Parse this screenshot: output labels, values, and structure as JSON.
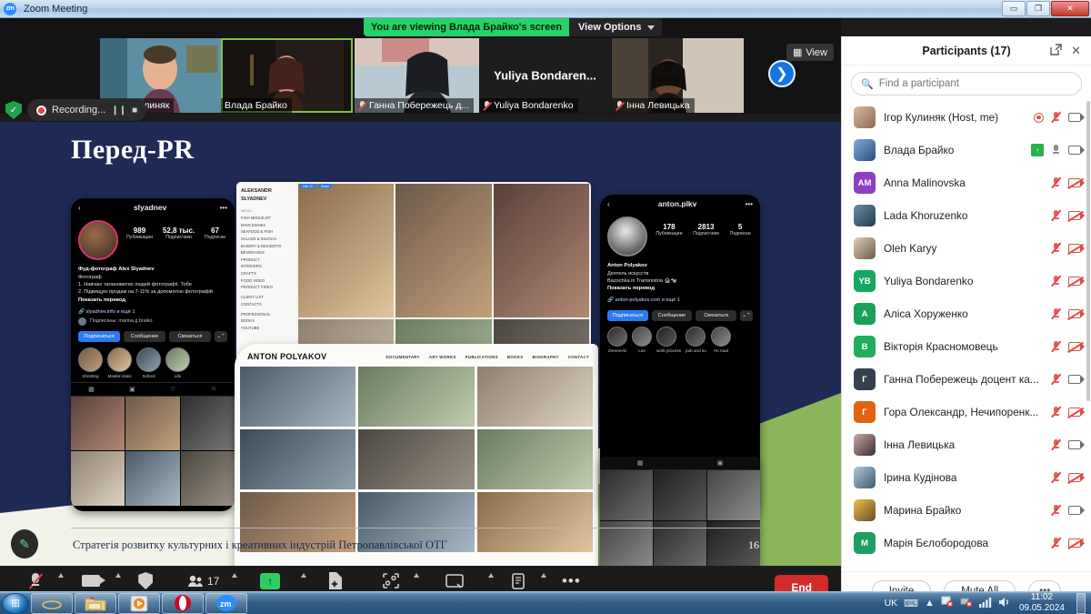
{
  "window": {
    "title": "Zoom Meeting",
    "app_icon": "zoom-icon",
    "minimize": "–",
    "restore": "❐",
    "close": "✕"
  },
  "share_banner": {
    "text": "You are viewing Влада Брайко's screen",
    "view_options": "View Options"
  },
  "recording": {
    "shield_icon": "encryption-shield-icon",
    "label": "Recording...",
    "pause_icon": "❙❙",
    "stop_icon": "■"
  },
  "filmstrip": {
    "view_button": "View",
    "next_icon": "❯",
    "thumbs": [
      {
        "name": "Ігор Кулиняк",
        "muted": true,
        "active": false,
        "centered": false
      },
      {
        "name": "Влада Брайко",
        "muted": false,
        "active": true,
        "centered": false
      },
      {
        "name": "Ганна Побережець д...",
        "muted": true,
        "active": false,
        "centered": false
      },
      {
        "name": "Yuliya Bondarenko",
        "center_name": "Yuliya  Bondaren...",
        "muted": true,
        "active": false,
        "centered": true
      },
      {
        "name": "Інна Левицька",
        "muted": true,
        "active": false,
        "centered": false
      }
    ]
  },
  "slide": {
    "title": "Перед-PR",
    "footer_text": "Стратегія розвитку культурних і креативних індустрій Петропавлівської ОТГ",
    "page_number": "16",
    "annotate_icon": "pen-icon",
    "phone1": {
      "back_icon": "‹",
      "handle": "slyadnev",
      "more_icon": "•••",
      "stats": [
        {
          "value": "989",
          "label": "Публикации"
        },
        {
          "value": "52,8 тыс.",
          "label": "Подписчики"
        },
        {
          "value": "67",
          "label": "Подписки"
        }
      ],
      "bio_name": "Фуд-фотограф Alex Slyadnev",
      "bio_category": "Фотограф",
      "bio_line1": "1. Навчаю талановитих людей фотографії. Тобе",
      "bio_line2": "2. Підвищую продаж на 7-11% за допомогою фотографій",
      "translate": "Показать перевод",
      "link": "slyadnev.info и ещё 1",
      "followed_by": "Подписаны: marina.g.braiko",
      "buttons": [
        "Подписаться",
        "Сообщение",
        "Связаться",
        "⌄⌃"
      ],
      "highlights": [
        "Shooting",
        "Master-class",
        "School",
        "Life"
      ],
      "tabs": [
        "▦",
        "▣",
        "♡",
        "☺"
      ]
    },
    "phone2": {
      "back_icon": "‹",
      "handle": "anton.plkv",
      "more_icon": "•••",
      "stats": [
        {
          "value": "178",
          "label": "Публикации"
        },
        {
          "value": "2813",
          "label": "Подписчики"
        },
        {
          "value": "5",
          "label": "Подписки"
        }
      ],
      "bio_name": "Anton Polyakov",
      "bio_category": "Деятель искусств",
      "bio_line1": "Bazochka in Transnistria 🏚🐄",
      "translate": "Показать перевод",
      "link": "anton-polyakov.com и ещё 1",
      "buttons": [
        "Подписаться",
        "Сообщение",
        "Связаться",
        "⌄⌃"
      ],
      "highlights": [
        "Zemeevsi",
        "Les",
        "work process",
        "pub and so",
        "I'm road"
      ],
      "tabs": [
        "▦",
        "▣"
      ]
    },
    "web1": {
      "brand": "ALEKSANDR SLYADNEV",
      "menu_label": "MENU",
      "menu_items": [
        "FISH MENU/LIST",
        "MAIN DISHES",
        "SEAFOOD & FISH",
        "SALADS & SNACKS",
        "BAKERY & DESSERTS",
        "BEVERAGES",
        "PRODUCT",
        "INTERIORS",
        "CRAFTS",
        "FOOD VIDEO",
        "PRODUCT VIDEO",
        "CLIENT LIST",
        "CONTACTS",
        "PROFESSIONAL",
        "BOOKS",
        "YOUTUBE"
      ],
      "top_buttons": [
        "Like 12",
        "Share"
      ]
    },
    "web2": {
      "brand": "ANTON POLYAKOV",
      "nav": [
        "DOCUMENTARY",
        "ART WORKS",
        "PUBLICATIONS",
        "BOOKS",
        "BIOGRAPHY",
        "CONTACT"
      ]
    }
  },
  "toolbar": {
    "items": [
      {
        "label": "Unmute",
        "icon": "mic-muted-icon",
        "caret": true
      },
      {
        "label": "Stop Video",
        "icon": "camera-icon",
        "caret": true
      },
      {
        "label": "Security",
        "icon": "shield-icon",
        "caret": false
      },
      {
        "label": "Participants",
        "icon": "participants-icon",
        "caret": true,
        "count": "17"
      },
      {
        "label": "Share Screen",
        "icon": "share-screen-icon",
        "caret": true
      },
      {
        "label": "Summary",
        "icon": "summary-icon",
        "caret": false
      },
      {
        "label": "Apps",
        "icon": "apps-icon",
        "caret": true
      },
      {
        "label": "Whiteboards",
        "icon": "whiteboard-icon",
        "caret": true
      },
      {
        "label": "Notes",
        "icon": "notes-icon",
        "caret": true
      },
      {
        "label": "More",
        "icon": "more-dots-icon",
        "caret": false
      }
    ],
    "end_label": "End"
  },
  "panel": {
    "title": "Participants (17)",
    "popout_icon": "popout-icon",
    "close_icon": "✕",
    "search": {
      "placeholder": "Find a participant",
      "value": "",
      "icon": "search-icon"
    },
    "participants": [
      {
        "name": "Ігор Кулиняк (Host, me)",
        "initials": "",
        "avatar_color": "photo-a",
        "recording": true,
        "mic": "muted",
        "cam": "on"
      },
      {
        "name": "Влада Брайко",
        "initials": "",
        "avatar_color": "photo-b",
        "sharing": true,
        "mic": "on",
        "cam": "on"
      },
      {
        "name": "Anna Malinovska",
        "initials": "AM",
        "avatar_color": "#8b3fc4",
        "mic": "muted",
        "cam": "muted"
      },
      {
        "name": "Lada Khoruzenko",
        "initials": "",
        "avatar_color": "photo-c",
        "mic": "muted",
        "cam": "muted"
      },
      {
        "name": "Oleh Karyy",
        "initials": "",
        "avatar_color": "photo-d",
        "mic": "muted",
        "cam": "muted"
      },
      {
        "name": "Yuliya Bondarenko",
        "initials": "YB",
        "avatar_color": "#16a765",
        "mic": "muted",
        "cam": "muted"
      },
      {
        "name": "Аліса Хоруженко",
        "initials": "A",
        "avatar_color": "#1aa05a",
        "mic": "muted",
        "cam": "muted"
      },
      {
        "name": "Вікторія Красномовець",
        "initials": "В",
        "avatar_color": "#21ad5c",
        "mic": "muted",
        "cam": "muted"
      },
      {
        "name": "Ганна Побережець доцент ка...",
        "initials": "Г",
        "avatar_color": "#36404f",
        "mic": "muted",
        "cam": "on"
      },
      {
        "name": "Гора Олександр, Нечипоренк...",
        "initials": "Г",
        "avatar_color": "#e2620d",
        "mic": "muted",
        "cam": "muted"
      },
      {
        "name": "Інна Левицька",
        "initials": "",
        "avatar_color": "photo-e",
        "mic": "muted",
        "cam": "on"
      },
      {
        "name": "Ірина  Кудінова",
        "initials": "",
        "avatar_color": "photo-f",
        "mic": "muted",
        "cam": "muted"
      },
      {
        "name": "Марина Брайко",
        "initials": "",
        "avatar_color": "photo-g",
        "mic": "muted",
        "cam": "on"
      },
      {
        "name": "Марія Бєлобородова",
        "initials": "M",
        "avatar_color": "#1f9e62",
        "mic": "muted",
        "cam": "muted"
      }
    ],
    "invite_label": "Invite",
    "mute_all_label": "Mute All",
    "more_label": "•••"
  },
  "taskbar": {
    "start_icon": "windows-start-icon",
    "apps": [
      {
        "icon": "internet-explorer-icon"
      },
      {
        "icon": "file-explorer-icon"
      },
      {
        "icon": "media-player-icon"
      },
      {
        "icon": "opera-icon"
      },
      {
        "icon": "zoom-icon"
      }
    ],
    "tray": {
      "language": "UK",
      "keyboard_icon": "keyboard-icon",
      "show_hidden_icon": "▲",
      "flag_icon": "flag-error-icon",
      "network_icon": "network-error-icon",
      "signal_icon": "signal-icon",
      "volume_icon": "volume-icon"
    },
    "time": "11:02",
    "date": "09.05.2024"
  }
}
